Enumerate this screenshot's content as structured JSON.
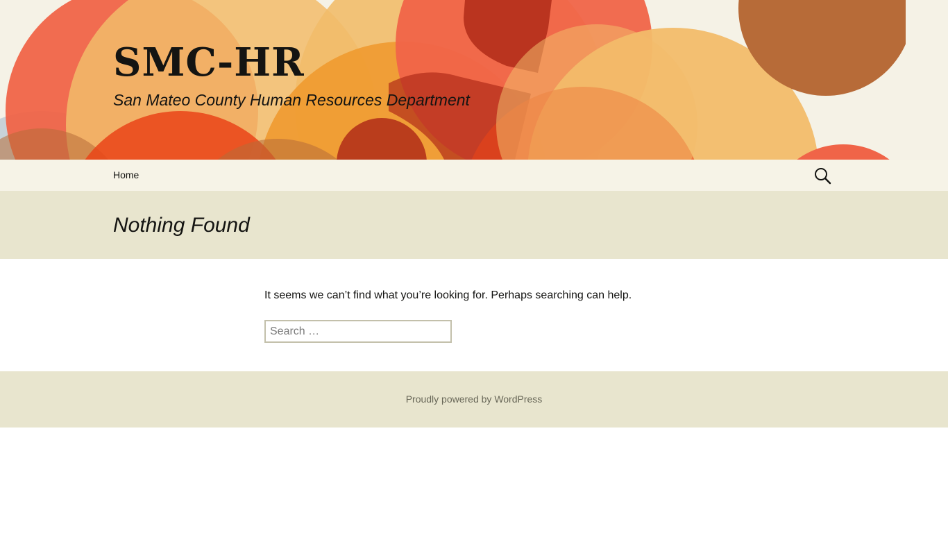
{
  "header": {
    "site_title": "SMC-HR",
    "site_description": "San Mateo County Human Resources Department",
    "art_colors": {
      "red": "#f06448",
      "orange_red": "#ea4418",
      "orange": "#ef9a30",
      "peach": "#f2bc6a",
      "brown": "#b76b38",
      "dark_red": "#b02c18",
      "blue_gray": "#c3ced6"
    }
  },
  "nav": {
    "items": [
      {
        "label": "Home"
      }
    ],
    "search_icon": "search-icon"
  },
  "main": {
    "page_title": "Nothing Found",
    "message": "It seems we can’t find what you’re looking for. Perhaps searching can help.",
    "search": {
      "placeholder": "Search …",
      "value": ""
    }
  },
  "footer": {
    "credit": "Proudly powered by WordPress"
  },
  "colors": {
    "header_bg": "#f5f2e6",
    "nav_bg": "#f6f3e7",
    "band_bg": "#e8e5ce",
    "text": "#141412",
    "footer_text": "#686758"
  }
}
